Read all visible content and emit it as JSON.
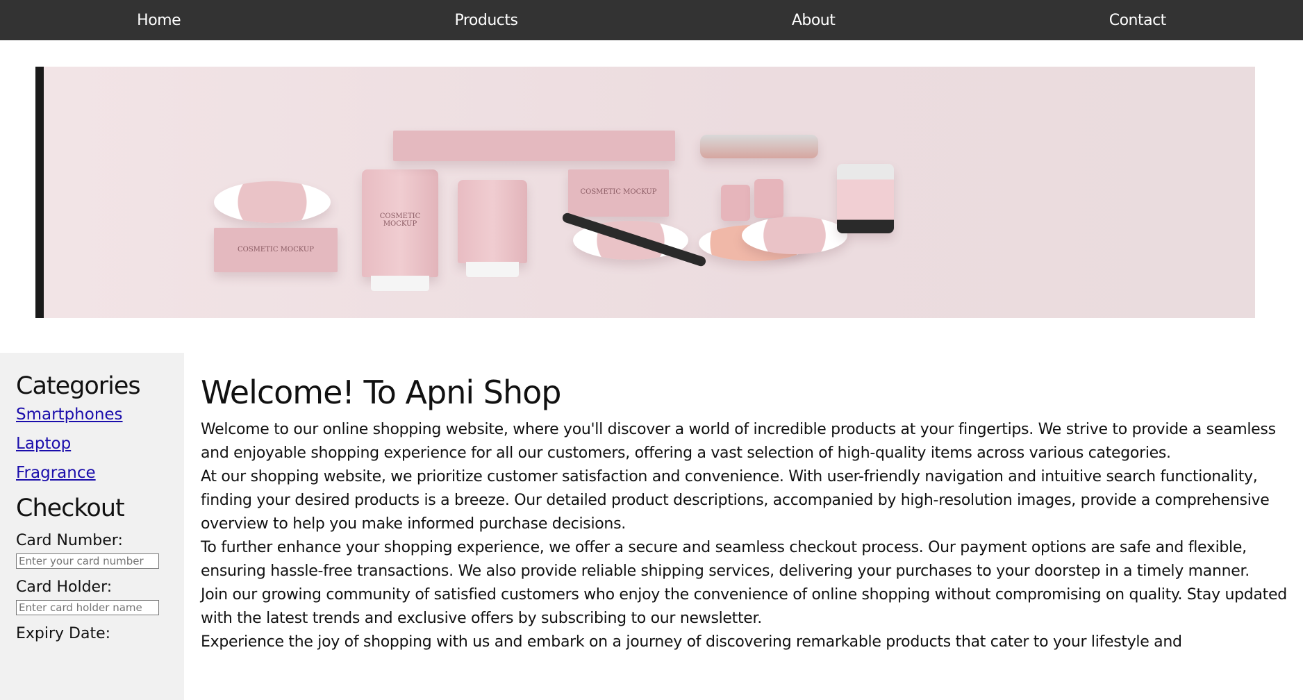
{
  "nav": {
    "home": "Home",
    "products": "Products",
    "about": "About",
    "contact": "Contact"
  },
  "sidebar": {
    "categories_title": "Categories",
    "categories": [
      "Smartphones",
      "Laptop",
      "Fragrance"
    ],
    "checkout_title": "Checkout",
    "card_number_label": "Card Number:",
    "card_number_placeholder": "Enter your card number",
    "card_holder_label": "Card Holder:",
    "card_holder_placeholder": "Enter card holder name",
    "expiry_label": "Expiry Date:"
  },
  "main": {
    "title": "Welcome! To Apni Shop",
    "paragraphs": [
      "Welcome to our online shopping website, where you'll discover a world of incredible products at your fingertips. We strive to provide a seamless and enjoyable shopping experience for all our customers, offering a vast selection of high-quality items across various categories.",
      "At our shopping website, we prioritize customer satisfaction and convenience. With user-friendly navigation and intuitive search functionality, finding your desired products is a breeze. Our detailed product descriptions, accompanied by high-resolution images, provide a comprehensive overview to help you make informed purchase decisions.",
      "To further enhance your shopping experience, we offer a secure and seamless checkout process. Our payment options are safe and flexible, ensuring hassle-free transactions. We also provide reliable shipping services, delivering your purchases to your doorstep in a timely manner.",
      "Join our growing community of satisfied customers who enjoy the convenience of online shopping without compromising on quality. Stay updated with the latest trends and exclusive offers by subscribing to our newsletter.",
      "Experience the joy of shopping with us and embark on a journey of discovering remarkable products that cater to your lifestyle and"
    ]
  },
  "hero": {
    "product_text": "COSMETIC MOCKUP"
  },
  "colors": {
    "navbar_bg": "#333333",
    "sidebar_bg": "#f1f1f1",
    "link": "#1a0dab",
    "hero_bg": "#f2e4e6"
  }
}
